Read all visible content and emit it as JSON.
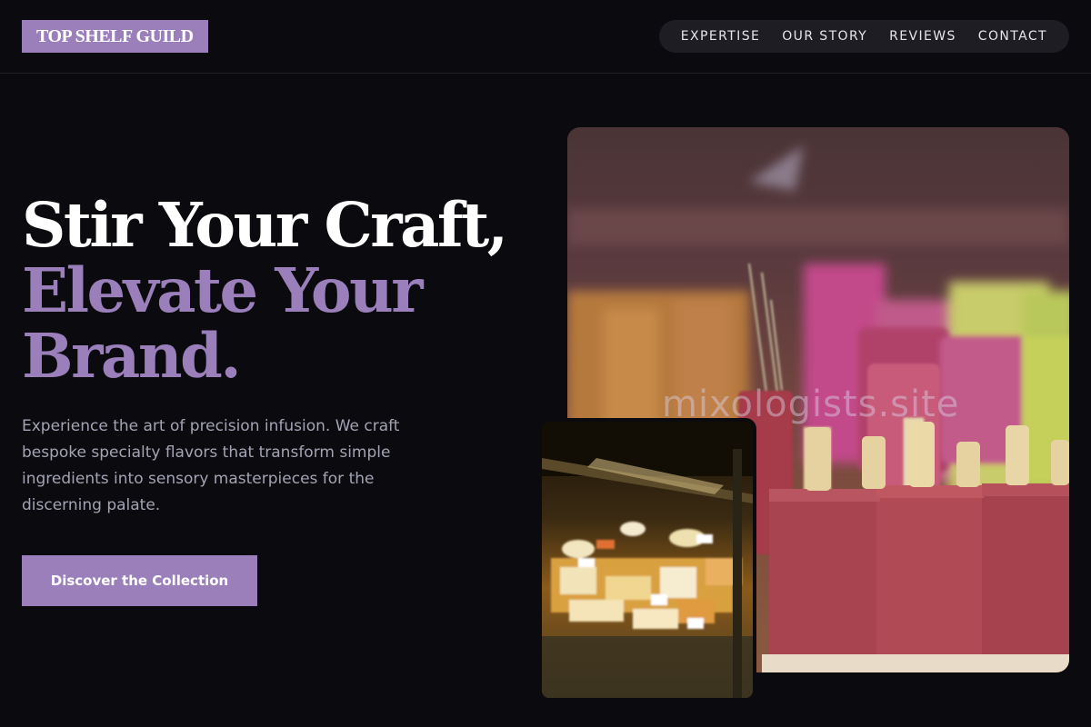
{
  "brand": {
    "logo_text": "TOP SHELF GUILD"
  },
  "nav": {
    "items": [
      "EXPERTISE",
      "OUR STORY",
      "REVIEWS",
      "CONTACT"
    ]
  },
  "hero": {
    "headline_line1": "Stir Your Craft,",
    "headline_line2": "Elevate Your",
    "headline_line3": "Brand.",
    "lead": "Experience the art of precision infusion. We craft bespoke specialty flavors that transform simple ingredients into sensory masterpieces for the discerning palate.",
    "cta_label": "Discover the Collection",
    "watermark": "mixologists.site"
  },
  "colors": {
    "background": "#0b0b0f",
    "accent": "#9a7fbb",
    "muted_text": "#a3a3b4"
  }
}
